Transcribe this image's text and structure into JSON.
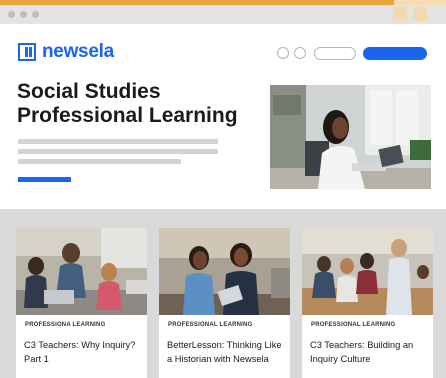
{
  "brand": {
    "name": "newsela",
    "color": "#1a64f0"
  },
  "header": {
    "title_line1": "Social Studies",
    "title_line2": "Professional Learning"
  },
  "cards": [
    {
      "tag": "PROFESSIONA LEARNING",
      "title": "C3 Teachers: Why Inquiry? Part 1"
    },
    {
      "tag": "PROFESSIONAL LEARNING",
      "title": "BetterLesson: Thinking Like a Historian with Newsela"
    },
    {
      "tag": "PROFESSIONAL LEARNING",
      "title": "C3 Teachers: Building an Inquiry Culture"
    }
  ],
  "colors": {
    "accent_stripe": "#e8a53a",
    "primary_button": "#1a64f0",
    "background": "#d9d9d9"
  }
}
